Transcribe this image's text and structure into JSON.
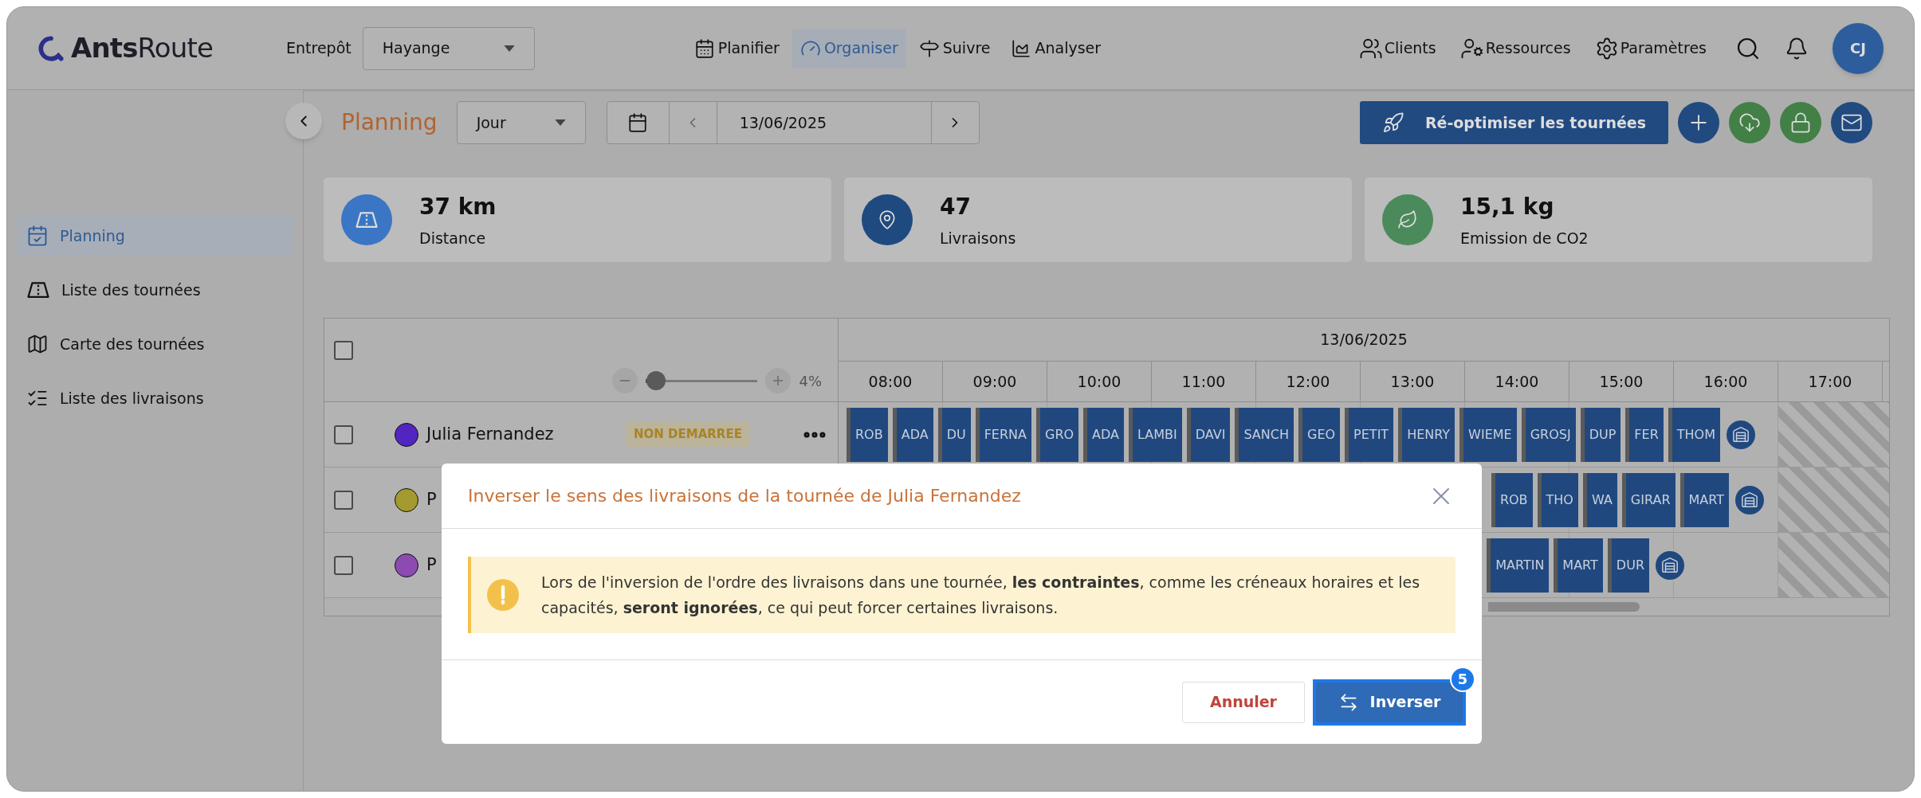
{
  "header": {
    "logo": "**Ants**Route",
    "warehouse_label": "Entrepôt",
    "warehouse": "Hayange",
    "nav": [
      {
        "label": "Planifier",
        "selected": false
      },
      {
        "label": "Organiser",
        "selected": true
      },
      {
        "label": "Suivre",
        "selected": false
      },
      {
        "label": "Analyser",
        "selected": false
      }
    ],
    "links": [
      "Clients",
      "Ressources",
      "Paramètres"
    ],
    "avatar": "CJ"
  },
  "sidebar": {
    "items": [
      {
        "label": "Planning",
        "selected": true
      },
      {
        "label": "Liste des tournées",
        "selected": false
      },
      {
        "label": "Carte des tournées",
        "selected": false
      },
      {
        "label": "Liste des livraisons",
        "selected": false
      }
    ]
  },
  "toolbar": {
    "title": "Planning",
    "view": "Jour",
    "date": "13/06/2025",
    "optimize_button": "Ré-optimiser les tournées"
  },
  "stats": [
    {
      "value": "37 km",
      "label": "Distance",
      "color": "#3a76c4"
    },
    {
      "value": "47",
      "label": "Livraisons",
      "color": "#1f4a80"
    },
    {
      "value": "15,1 kg",
      "label": "Emission de CO2",
      "color": "#4b8a5a"
    }
  ],
  "gantt": {
    "all_checked": false,
    "date": "13/06/2025",
    "zoom": {
      "level": 0.05,
      "reading": "4%"
    },
    "hours": [
      "08:00",
      "09:00",
      "10:00",
      "11:00",
      "12:00",
      "13:00",
      "14:00",
      "15:00",
      "16:00",
      "17:00"
    ],
    "rows": [
      {
        "checked": false,
        "name": "Julia Fernandez",
        "color": "#5224c0",
        "status": "NON DEMARREE",
        "stops": [
          "ROB",
          "ADA",
          "DU",
          "FERNA",
          "GRO",
          "ADA",
          "LAMBI",
          "DAVI",
          "SANCH",
          "GEO",
          "PETIT",
          "HENRY",
          "WIEME",
          "GROSJ",
          "DUP",
          "FER",
          "THOM"
        ]
      },
      {
        "checked": false,
        "name": "P",
        "color": "#a39a30",
        "stops": [
          "ROB",
          "THO",
          "WA",
          "GIRAR",
          "MART"
        ]
      },
      {
        "checked": false,
        "name": "P",
        "color": "#8c4bb0",
        "stops": [
          "MARTIN",
          "MART",
          "DUR"
        ]
      }
    ]
  },
  "dialog": {
    "title": "Inverser le sens des livraisons de la tournée de Julia Fernandez",
    "message": "Lors de l'inversion de l'ordre des livraisons dans une tournée, **les contraintes**, comme les créneaux horaires et les capacités, **seront ignorées**, ce qui peut forcer certaines livraisons.",
    "cancel": "Annuler",
    "confirm": "Inverser",
    "step_badge": "5"
  }
}
